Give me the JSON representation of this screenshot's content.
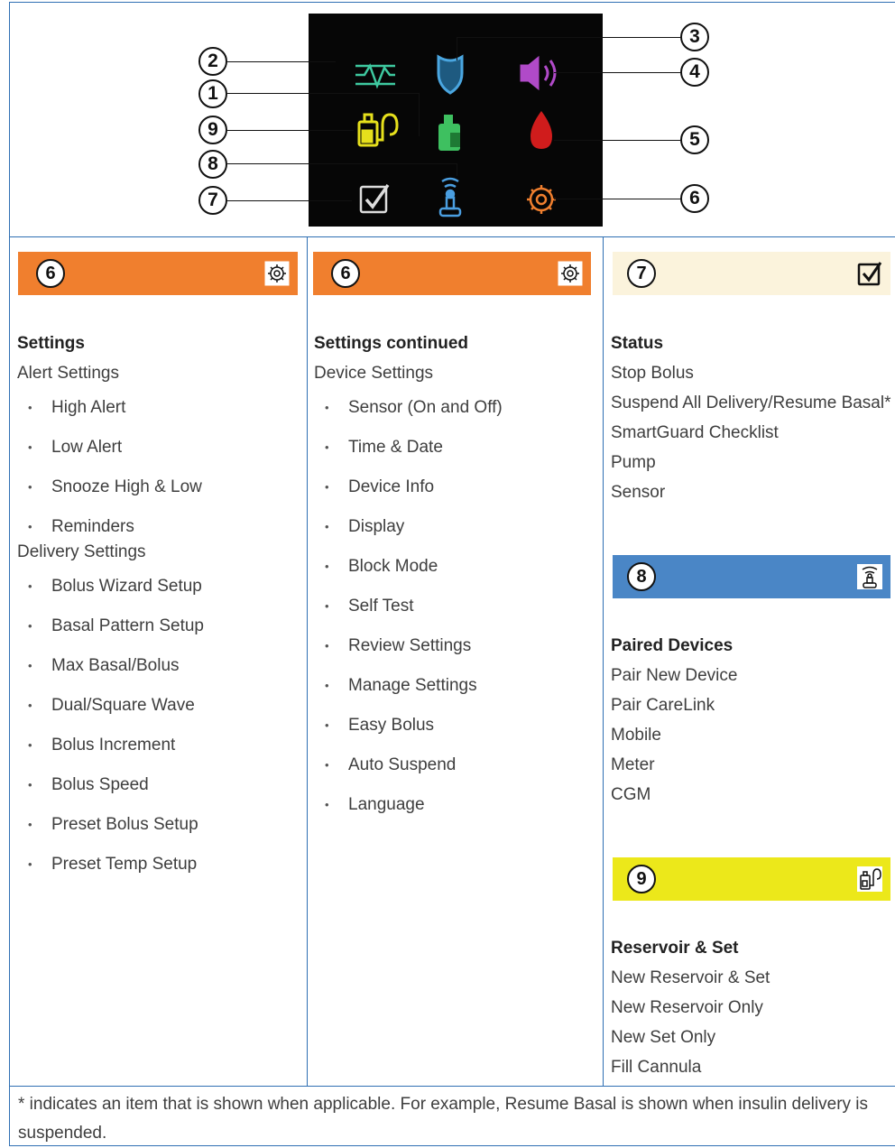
{
  "callouts": [
    "1",
    "2",
    "3",
    "4",
    "5",
    "6",
    "7",
    "8",
    "9"
  ],
  "icons": {
    "graph": "sensor-graph-icon",
    "shield": "smartguard-shield-icon",
    "audio": "audio-speaker-icon",
    "reservoir": "reservoir-icon",
    "drop": "bolus-drop-icon",
    "reservoir_set": "reservoir-and-set-icon",
    "paired": "paired-devices-icon",
    "status": "status-checkbox-icon",
    "settings": "settings-gear-icon"
  },
  "colors": {
    "settings": "#f07f2e",
    "status": "#fbf3dc",
    "paired": "#4a86c6",
    "reservoir": "#ece81a",
    "border": "#2f6fb3"
  },
  "col1": {
    "badge": "6",
    "title": "Settings",
    "section1": "Alert Settings",
    "items1": [
      "High Alert",
      "Low Alert",
      "Snooze High & Low",
      "Reminders"
    ],
    "section2": "Delivery Settings",
    "items2": [
      "Bolus Wizard Setup",
      "Basal Pattern Setup",
      "Max Basal/Bolus",
      "Dual/Square Wave",
      "Bolus Increment",
      "Bolus Speed",
      "Preset Bolus Setup",
      "Preset Temp Setup"
    ]
  },
  "col2": {
    "badge": "6",
    "title": "Settings continued",
    "section1": "Device Settings",
    "items1": [
      "Sensor (On and Off)",
      "Time & Date",
      "Device Info",
      "Display",
      "Block Mode",
      "Self Test",
      "Review Settings",
      "Manage Settings",
      "Easy Bolus",
      "Auto Suspend",
      "Language"
    ]
  },
  "col3": {
    "status": {
      "badge": "7",
      "title": "Status",
      "lines": [
        "Stop Bolus",
        "Suspend All Delivery/Resume Basal*",
        "SmartGuard Checklist",
        "Pump",
        "Sensor"
      ]
    },
    "paired": {
      "badge": "8",
      "title": "Paired Devices",
      "lines": [
        "Pair New Device",
        "Pair CareLink",
        "Mobile",
        "Meter",
        "CGM"
      ]
    },
    "reservoir": {
      "badge": "9",
      "title": "Reservoir & Set",
      "lines": [
        "New Reservoir & Set",
        "New Reservoir Only",
        "New Set Only",
        "Fill Cannula"
      ]
    }
  },
  "footnote": "* indicates an item that is shown when applicable. For example, Resume Basal is shown when insulin delivery is suspended."
}
